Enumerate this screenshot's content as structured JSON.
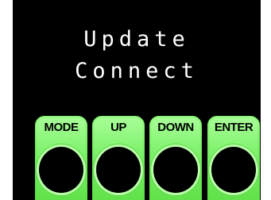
{
  "display": {
    "line1": "Update",
    "line2": "Connect"
  },
  "buttons": [
    {
      "label": "MODE"
    },
    {
      "label": "UP"
    },
    {
      "label": "DOWN"
    },
    {
      "label": "ENTER"
    }
  ],
  "colors": {
    "background": "#000000",
    "text": "#ffffff",
    "button_green": "#7cf06a",
    "button_rim": "#b8ffa8"
  }
}
